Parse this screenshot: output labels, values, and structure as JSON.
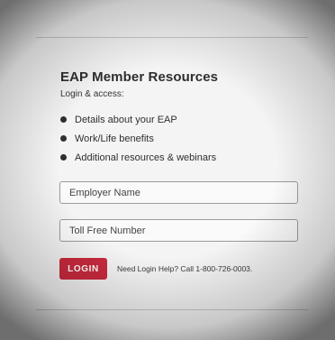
{
  "panel": {
    "title": "EAP Member Resources",
    "subtitle": "Login & access:",
    "bullets": [
      "Details about your EAP",
      "Work/Life benefits",
      "Additional resources & webinars"
    ]
  },
  "form": {
    "employer_placeholder": "Employer Name",
    "phone_placeholder": "Toll Free Number",
    "login_label": "LOGIN",
    "help_text": "Need Login Help? Call 1-800-726-0003."
  },
  "colors": {
    "login_button": "#c92a3d",
    "background": "#f4f4f4"
  }
}
